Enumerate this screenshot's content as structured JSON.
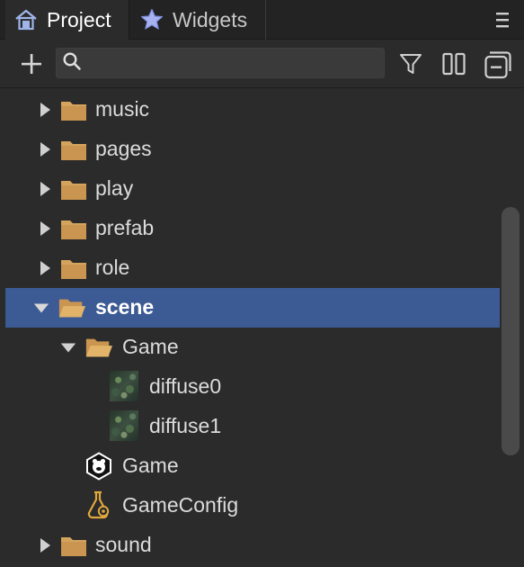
{
  "tabs": [
    {
      "label": "Project",
      "icon": "house-icon",
      "active": true
    },
    {
      "label": "Widgets",
      "icon": "star-icon",
      "active": false
    }
  ],
  "toolbar": {
    "add_icon": "plus-icon",
    "search_placeholder": "",
    "search_value": "",
    "filter_icon": "filter-icon",
    "split_icon": "split-view-icon",
    "collapse_icon": "collapse-all-icon"
  },
  "tree": [
    {
      "label": "music",
      "type": "folder",
      "expanded": false
    },
    {
      "label": "pages",
      "type": "folder",
      "expanded": false
    },
    {
      "label": "play",
      "type": "folder",
      "expanded": false
    },
    {
      "label": "prefab",
      "type": "folder",
      "expanded": false
    },
    {
      "label": "role",
      "type": "folder",
      "expanded": false
    },
    {
      "label": "scene",
      "type": "folder",
      "expanded": true,
      "selected": true
    },
    {
      "label": "Game",
      "type": "folder",
      "expanded": true
    },
    {
      "label": "diffuse0",
      "type": "texture"
    },
    {
      "label": "diffuse1",
      "type": "texture"
    },
    {
      "label": "Game",
      "type": "scene"
    },
    {
      "label": "GameConfig",
      "type": "config"
    },
    {
      "label": "sound",
      "type": "folder",
      "expanded": false
    }
  ],
  "colors": {
    "selection": "#3c5a94",
    "folder": "#d4a45c",
    "background": "#2b2b2b"
  }
}
